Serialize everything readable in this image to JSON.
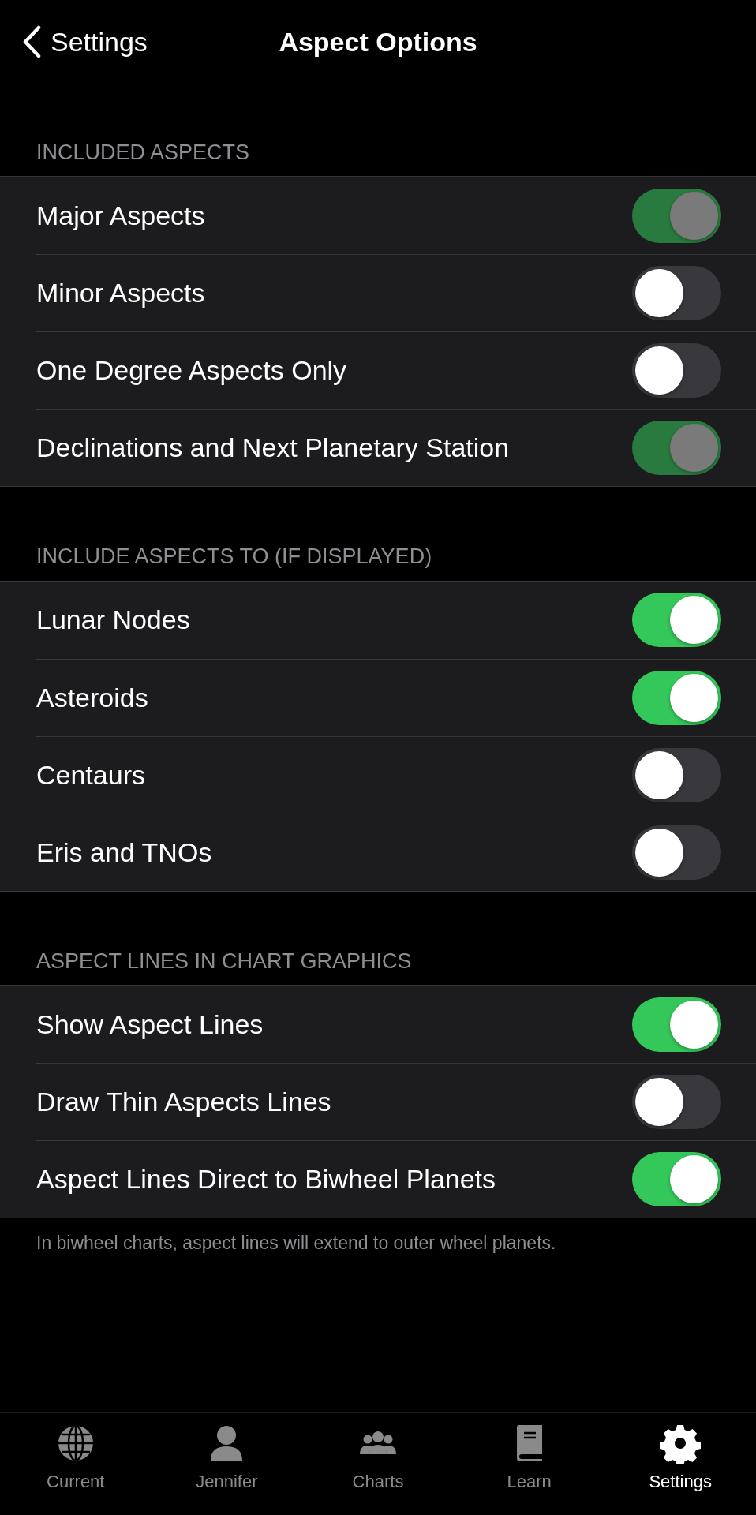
{
  "nav": {
    "back_label": "Settings",
    "title": "Aspect Options"
  },
  "sections": [
    {
      "header": "INCLUDED ASPECTS",
      "rows": [
        {
          "label": "Major Aspects",
          "on": true,
          "disabled": true
        },
        {
          "label": "Minor Aspects",
          "on": false,
          "disabled": false
        },
        {
          "label": "One Degree Aspects Only",
          "on": false,
          "disabled": false
        },
        {
          "label": "Declinations and Next Planetary Station",
          "on": true,
          "disabled": true
        }
      ]
    },
    {
      "header": "INCLUDE ASPECTS TO (IF DISPLAYED)",
      "rows": [
        {
          "label": "Lunar Nodes",
          "on": true,
          "disabled": false
        },
        {
          "label": "Asteroids",
          "on": true,
          "disabled": false
        },
        {
          "label": "Centaurs",
          "on": false,
          "disabled": false
        },
        {
          "label": "Eris and TNOs",
          "on": false,
          "disabled": false
        }
      ]
    },
    {
      "header": "ASPECT LINES IN CHART GRAPHICS",
      "rows": [
        {
          "label": "Show Aspect Lines",
          "on": true,
          "disabled": false
        },
        {
          "label": "Draw Thin Aspects Lines",
          "on": false,
          "disabled": false
        },
        {
          "label": "Aspect Lines Direct to Biwheel Planets",
          "on": true,
          "disabled": false
        }
      ],
      "footer": "In biwheel charts, aspect lines will extend to outer wheel planets."
    }
  ],
  "tab_bar": [
    {
      "kind": "globe",
      "label": "Current",
      "selected": false
    },
    {
      "kind": "person",
      "label": "Jennifer",
      "selected": false
    },
    {
      "kind": "group",
      "label": "Charts",
      "selected": false
    },
    {
      "kind": "book",
      "label": "Learn",
      "selected": false
    },
    {
      "kind": "gear",
      "label": "Settings",
      "selected": true
    }
  ]
}
